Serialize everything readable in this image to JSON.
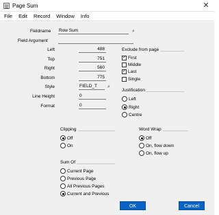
{
  "window": {
    "title": "Page Sum",
    "close_glyph": "✕"
  },
  "menu": [
    "File",
    "Edit",
    "Record",
    "Window",
    "Info"
  ],
  "fields": {
    "fieldname": {
      "label": "Fieldname",
      "value": "Row Sum"
    },
    "field_argument": {
      "label": "Field Argument",
      "value": ""
    },
    "left": {
      "label": "Left",
      "value": "488"
    },
    "top": {
      "label": "Top",
      "value": "751"
    },
    "right": {
      "label": "Right",
      "value": "560"
    },
    "bottom": {
      "label": "Bottom",
      "value": "775"
    },
    "style": {
      "label": "Style",
      "value": "FIELD_T"
    },
    "line_height": {
      "label": "Line Height",
      "value": "0"
    },
    "format": {
      "label": "Format",
      "value": "0"
    }
  },
  "exclude": {
    "title": "Exclude from page",
    "items": [
      {
        "label": "First",
        "checked": true
      },
      {
        "label": "Middle",
        "checked": false
      },
      {
        "label": "Last",
        "checked": true
      },
      {
        "label": "Single",
        "checked": false
      }
    ]
  },
  "justification": {
    "title": "Justification",
    "options": [
      {
        "label": "Left",
        "selected": false
      },
      {
        "label": "Right",
        "selected": true
      },
      {
        "label": "Centre",
        "selected": false
      }
    ]
  },
  "clipping": {
    "title": "Clipping",
    "options": [
      {
        "label": "Off",
        "selected": true
      },
      {
        "label": "On",
        "selected": false
      }
    ]
  },
  "word_wrap": {
    "title": "Word Wrap",
    "options": [
      {
        "label": "Off",
        "selected": true
      },
      {
        "label": "On, flow down",
        "selected": false
      },
      {
        "label": "On, flow up",
        "selected": false
      }
    ]
  },
  "sum_of": {
    "title": "Sum Of",
    "options": [
      {
        "label": "Current Page",
        "selected": false
      },
      {
        "label": "Previous Page",
        "selected": false
      },
      {
        "label": "All Previous Pages",
        "selected": false
      },
      {
        "label": "Current and Previous",
        "selected": true
      }
    ]
  },
  "buttons": {
    "ok": "OK",
    "cancel": "Cancel"
  },
  "colors": {
    "button": "#0a62c4",
    "panel": "#f0f0f0"
  }
}
